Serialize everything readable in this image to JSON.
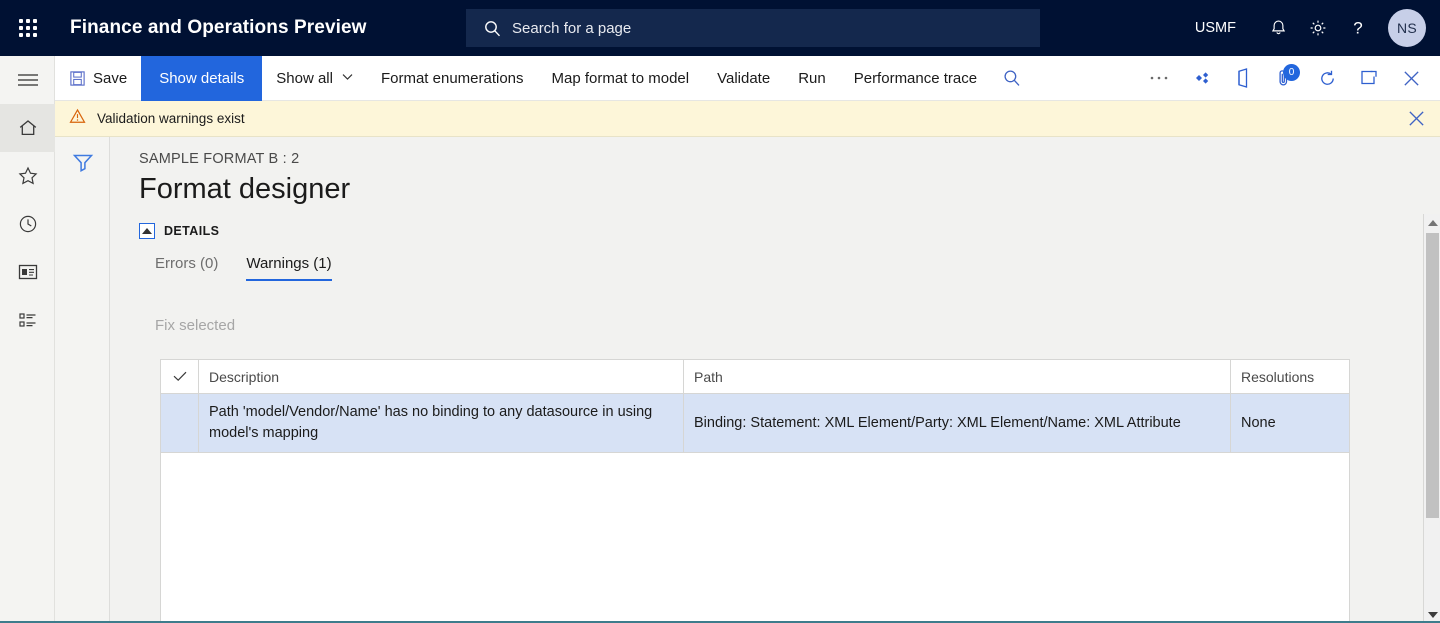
{
  "topbar": {
    "waffle_label": "app-launcher",
    "app_title": "Finance and Operations Preview",
    "search_placeholder": "Search for a page",
    "search_value": "",
    "company": "USMF",
    "avatar_initials": "NS",
    "icons": [
      "notifications-icon",
      "settings-gear-icon",
      "help-question-icon"
    ]
  },
  "rail": {
    "items": [
      {
        "name": "hamburger-menu",
        "label": "Expand the navigation pane"
      },
      {
        "name": "home",
        "label": "Home"
      },
      {
        "name": "favorites-star",
        "label": "Favorites"
      },
      {
        "name": "recent-clock",
        "label": "Recent"
      },
      {
        "name": "workspaces",
        "label": "Workspaces"
      },
      {
        "name": "modules-list",
        "label": "Modules"
      }
    ]
  },
  "toolbar": {
    "save_label": "Save",
    "show_details_label": "Show details",
    "show_all_label": "Show all",
    "format_enumerations_label": "Format enumerations",
    "map_format_to_model_label": "Map format to model",
    "validate_label": "Validate",
    "run_label": "Run",
    "performance_trace_label": "Performance trace",
    "search_icon_label": "search-icon",
    "attachment_badge_count": "0"
  },
  "message_bar": {
    "text": "Validation warnings exist",
    "type": "warning"
  },
  "content": {
    "breadcrumb": "SAMPLE FORMAT B : 2",
    "page_title": "Format designer",
    "details_section_label": "DETAILS",
    "tabs": [
      {
        "label": "Errors (0)",
        "active": false
      },
      {
        "label": "Warnings (1)",
        "active": true
      }
    ],
    "fix_selected_label": "Fix selected",
    "grid": {
      "columns": [
        "",
        "Description",
        "Path",
        "Resolutions"
      ],
      "rows": [
        {
          "checked": "",
          "description": "Path 'model/Vendor/Name' has no binding to any datasource in using model's mapping",
          "path": "Binding: Statement: XML Element/Party: XML Element/Name: XML Attribute",
          "resolutions": "None"
        }
      ]
    }
  },
  "colors": {
    "brand_navy": "#001133",
    "accent_blue": "#2266dd",
    "warning_bg": "#fdf6d9",
    "row_selected": "#d7e2f5"
  }
}
